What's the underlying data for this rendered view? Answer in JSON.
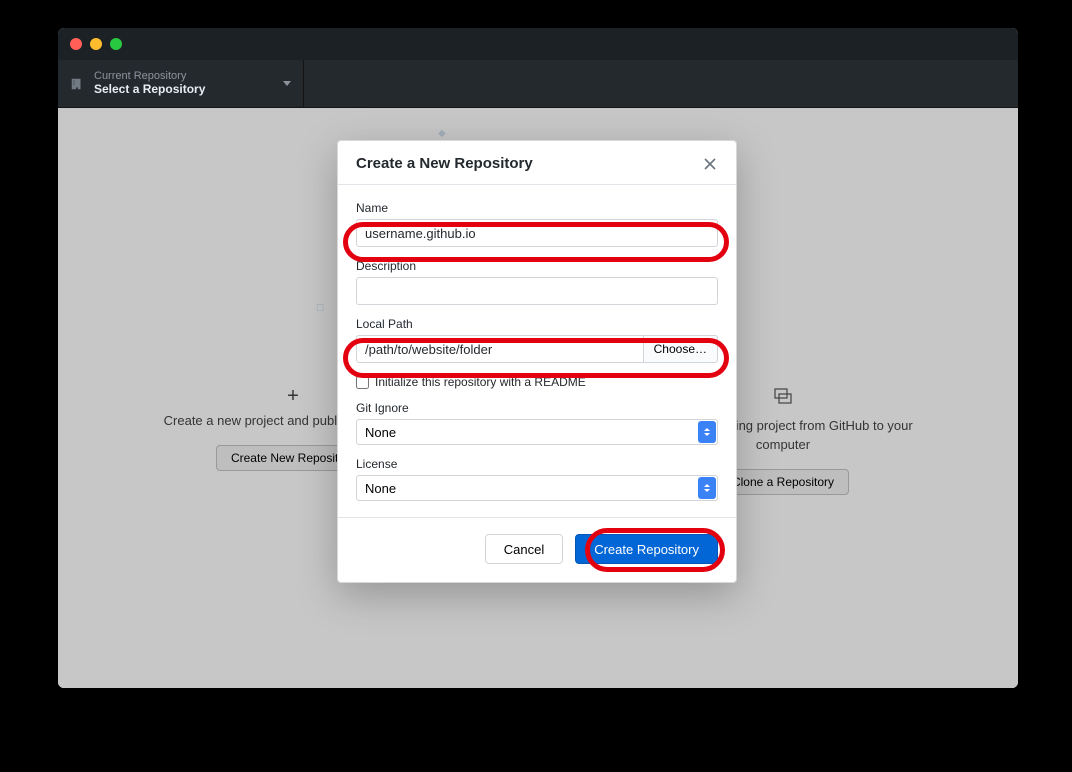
{
  "toolbar": {
    "repo_label": "Current Repository",
    "repo_value": "Select a Repository"
  },
  "welcome": {
    "left": {
      "text": "Create a new project and publish it to GitHub",
      "button": "Create New Repository"
    },
    "right": {
      "text": "Clone an existing project from GitHub to your computer",
      "button": "Clone a Repository"
    }
  },
  "modal": {
    "title": "Create a New Repository",
    "name_label": "Name",
    "name_value": "username.github.io",
    "description_label": "Description",
    "description_value": "",
    "localpath_label": "Local Path",
    "localpath_value": "/path/to/website/folder",
    "choose_label": "Choose…",
    "readme_label": "Initialize this repository with a README",
    "readme_checked": false,
    "gitignore_label": "Git Ignore",
    "gitignore_value": "None",
    "license_label": "License",
    "license_value": "None",
    "cancel": "Cancel",
    "submit": "Create Repository"
  }
}
